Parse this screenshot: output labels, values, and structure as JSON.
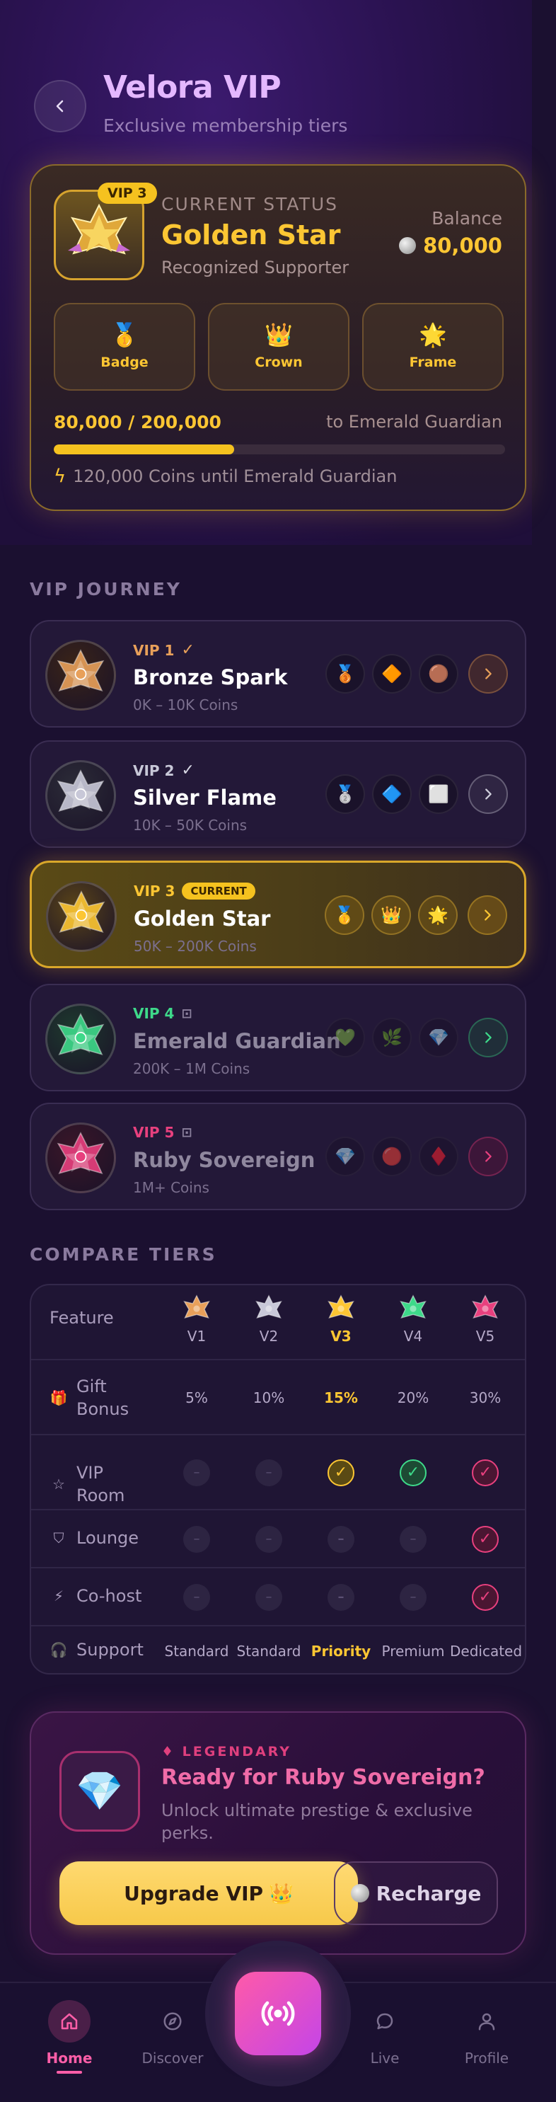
{
  "header": {
    "title": "Velora VIP",
    "subtitle": "Exclusive membership tiers"
  },
  "status": {
    "chip": "VIP 3",
    "label": "CURRENT STATUS",
    "tier_name": "Golden Star",
    "tier_sub": "Recognized Supporter",
    "balance_label": "Balance",
    "balance_value": "80,000",
    "perks": [
      {
        "icon": "🥇",
        "label": "Badge"
      },
      {
        "icon": "👑",
        "label": "Crown"
      },
      {
        "icon": "🌟",
        "label": "Frame"
      }
    ],
    "progress_text": "80,000 / 200,000",
    "progress_target": "to Emerald Guardian",
    "progress_fraction": 0.4,
    "progress_note": "120,000 Coins until Emerald Guardian"
  },
  "journey": {
    "title": "VIP JOURNEY",
    "current_badge": "CURRENT",
    "tiers": [
      {
        "level": "VIP 1",
        "mark": "✓",
        "name": "Bronze Spark",
        "range": "0K – 10K Coins",
        "color": "#e8a05a",
        "icons": [
          "🥉",
          "🔶",
          "🟤"
        ]
      },
      {
        "level": "VIP 2",
        "mark": "✓",
        "name": "Silver Flame",
        "range": "10K – 50K Coins",
        "color": "#c8c8d8",
        "icons": [
          "🥈",
          "🔷",
          "⬜"
        ]
      },
      {
        "level": "VIP 3",
        "mark": "",
        "name": "Golden Star",
        "range": "50K – 200K Coins",
        "color": "#fcc633",
        "icons": [
          "🥇",
          "👑",
          "🌟"
        ]
      },
      {
        "level": "VIP 4",
        "mark": "🔒",
        "name": "Emerald Guardian",
        "range": "200K – 1M Coins",
        "color": "#3ed98a",
        "icons": [
          "💚",
          "🌿",
          "💎"
        ]
      },
      {
        "level": "VIP 5",
        "mark": "🔒",
        "name": "Ruby Sovereign",
        "range": "1M+ Coins",
        "color": "#e8407e",
        "icons": [
          "💎",
          "🔴",
          "♦️"
        ]
      }
    ]
  },
  "compare": {
    "title": "COMPARE TIERS",
    "feature_header": "Feature",
    "columns": [
      "V1",
      "V2",
      "V3",
      "V4",
      "V5"
    ],
    "rows": [
      {
        "icon": "🎁",
        "label": "Gift Bonus",
        "values": [
          "5%",
          "10%",
          "15%",
          "20%",
          "30%"
        ]
      },
      {
        "icon": "☆",
        "label": "VIP Room",
        "values": [
          "–",
          "–",
          "✓",
          "✓",
          "✓"
        ]
      },
      {
        "icon": "⛉",
        "label": "Lounge",
        "values": [
          "–",
          "–",
          "–",
          "–",
          "✓"
        ]
      },
      {
        "icon": "⚡",
        "label": "Co-host",
        "values": [
          "–",
          "–",
          "–",
          "–",
          "✓"
        ]
      },
      {
        "icon": "🎧",
        "label": "Support",
        "values": [
          "Standard",
          "Standard",
          "Priority",
          "Premium",
          "Dedicated"
        ]
      }
    ]
  },
  "upgrade": {
    "tag": "♦ LEGENDARY",
    "title": "Ready for Ruby Sovereign?",
    "desc": "Unlock ultimate prestige & exclusive perks.",
    "upgrade_label": "Upgrade VIP",
    "upgrade_icon": "👑",
    "recharge_label": "Recharge"
  },
  "nav": {
    "items": [
      {
        "label": "Home",
        "icon": "home-icon"
      },
      {
        "label": "Discover",
        "icon": "compass-icon"
      },
      {
        "label": "Live",
        "icon": "chat-icon"
      },
      {
        "label": "Profile",
        "icon": "user-icon"
      }
    ]
  },
  "colors": {
    "gold": "#fcc633",
    "pink": "#ff5ea8",
    "emerald": "#3ed98a",
    "ruby": "#e8407e"
  }
}
